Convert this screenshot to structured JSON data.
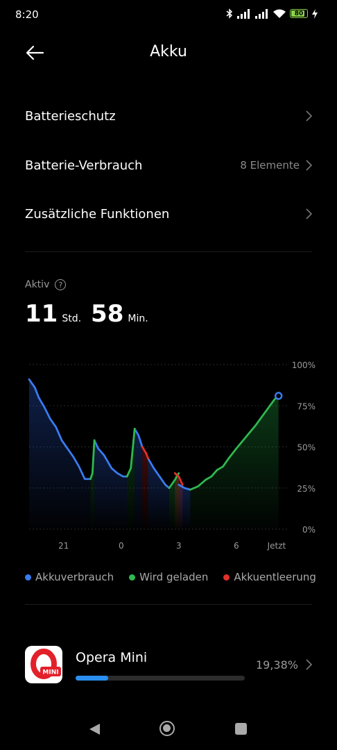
{
  "status_bar": {
    "time": "8:20",
    "battery_level": "80"
  },
  "header": {
    "title": "Akku"
  },
  "menu": [
    {
      "label": "Batterieschutz",
      "value": ""
    },
    {
      "label": "Batterie-Verbrauch",
      "value": "8 Elemente"
    },
    {
      "label": "Zusätzliche Funktionen",
      "value": ""
    }
  ],
  "active": {
    "label": "Aktiv",
    "hours": "11",
    "hours_unit": "Std.",
    "minutes": "58",
    "minutes_unit": "Min."
  },
  "chart_data": {
    "type": "line",
    "y_ticks": [
      "100%",
      "75%",
      "50%",
      "25%",
      "0%"
    ],
    "ylim": [
      0,
      100
    ],
    "x_ticks": [
      {
        "label": "21",
        "x": 21
      },
      {
        "label": "0",
        "x": 24
      },
      {
        "label": "3",
        "x": 27
      },
      {
        "label": "6",
        "x": 30
      },
      {
        "label": "Jetzt",
        "x": 32.1
      }
    ],
    "xlim": [
      19.2,
      32.5
    ],
    "grid": true,
    "series": [
      {
        "name": "Akkuverbrauch",
        "color": "#3a7bef",
        "segments": [
          [
            [
              19.2,
              91
            ],
            [
              19.5,
              86
            ],
            [
              19.7,
              80
            ],
            [
              20.0,
              74
            ],
            [
              20.3,
              67
            ],
            [
              20.6,
              62
            ],
            [
              20.9,
              54
            ],
            [
              21.2,
              49
            ],
            [
              21.5,
              44
            ],
            [
              21.8,
              38
            ],
            [
              22.0,
              33
            ],
            [
              22.1,
              30.5
            ],
            [
              22.4,
              30.5
            ]
          ],
          [
            [
              22.6,
              54
            ],
            [
              22.8,
              49
            ],
            [
              23.1,
              45
            ],
            [
              23.3,
              41
            ],
            [
              23.5,
              37
            ],
            [
              23.8,
              34
            ],
            [
              24.1,
              32
            ],
            [
              24.3,
              32
            ]
          ],
          [
            [
              24.7,
              61
            ],
            [
              24.9,
              57
            ],
            [
              25.1,
              50
            ]
          ],
          [
            [
              25.4,
              43
            ],
            [
              25.7,
              37
            ],
            [
              26.0,
              32
            ],
            [
              26.3,
              27
            ],
            [
              26.5,
              25
            ]
          ],
          [
            [
              27.0,
              27
            ],
            [
              27.3,
              25
            ],
            [
              27.6,
              24
            ]
          ]
        ]
      },
      {
        "name": "Wird geladen",
        "color": "#2fb84f",
        "segments": [
          [
            [
              22.4,
              30.5
            ],
            [
              22.5,
              34
            ],
            [
              22.6,
              54
            ]
          ],
          [
            [
              24.3,
              32
            ],
            [
              24.5,
              37
            ],
            [
              24.7,
              61
            ]
          ],
          [
            [
              26.5,
              25
            ],
            [
              26.8,
              30
            ],
            [
              27.0,
              34
            ]
          ],
          [
            [
              27.6,
              24
            ],
            [
              28.0,
              26
            ],
            [
              28.4,
              30
            ],
            [
              28.7,
              32
            ],
            [
              29.0,
              36
            ],
            [
              29.3,
              38
            ],
            [
              29.6,
              43
            ],
            [
              30.0,
              49
            ],
            [
              30.5,
              56
            ],
            [
              31.0,
              63
            ],
            [
              31.5,
              71
            ],
            [
              32.0,
              79
            ],
            [
              32.2,
              81
            ]
          ]
        ]
      },
      {
        "name": "Akkuentleerung",
        "color": "#e0322a",
        "segments": [
          [
            [
              25.1,
              50
            ],
            [
              25.3,
              46
            ],
            [
              25.4,
              43
            ]
          ],
          [
            [
              26.8,
              34
            ],
            [
              27.0,
              32
            ],
            [
              27.2,
              27
            ]
          ]
        ]
      }
    ],
    "end_point": {
      "x": 32.2,
      "y": 81
    }
  },
  "legend": [
    {
      "label": "Akkuverbrauch",
      "color": "#3a7bef"
    },
    {
      "label": "Wird geladen",
      "color": "#2fb84f"
    },
    {
      "label": "Akkuentleerung",
      "color": "#e0322a"
    }
  ],
  "apps": [
    {
      "name": "Opera Mini",
      "percent": "19,38%",
      "usage_fraction": 0.1938,
      "icon_badge": "MINI"
    }
  ]
}
